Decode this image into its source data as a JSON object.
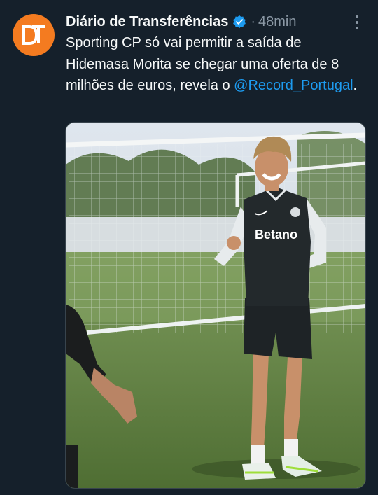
{
  "account": {
    "name": "Diário de Transferências",
    "separator": "·",
    "timestamp": "48min",
    "avatar_text": "DT"
  },
  "tweet": {
    "text_before": "Sporting CP só vai permitir a saída de Hidemasa Morita se chegar uma oferta de 8 milhões de euros, revela o ",
    "mention": "@Record_Portugal",
    "text_after": "."
  },
  "media": {
    "shirt_sponsor": "Betano"
  },
  "icons": {
    "verified": "verified-badge-icon",
    "more": "more-options-icon"
  },
  "colors": {
    "background": "#15202b",
    "link": "#1d9bf0",
    "avatar": "#f47b20",
    "muted": "#8b98a5"
  }
}
